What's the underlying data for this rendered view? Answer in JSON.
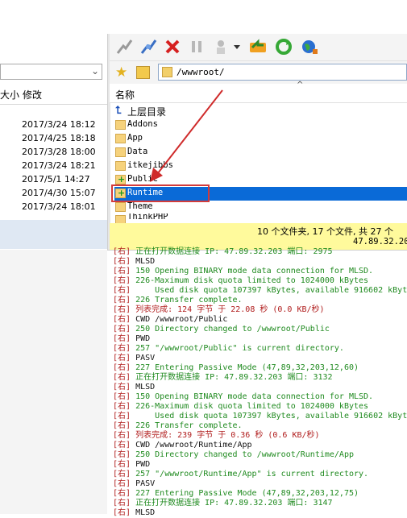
{
  "left": {
    "header_size": "大小",
    "header_modified": "修改",
    "dates": [
      "2017/3/24 18:12",
      "2017/4/25 18:18",
      "2017/3/28 18:00",
      "2017/3/24 18:21",
      "2017/5/1 14:27",
      "2017/4/30 15:07",
      "2017/3/24 18:01"
    ]
  },
  "right": {
    "path": "/wwwroot/",
    "col_name": "名称",
    "items": [
      "上层目录",
      "Addons",
      "App",
      "Data",
      "itkejibbs",
      "Public",
      "Runtime",
      "Theme",
      "ThinkPHP"
    ],
    "status_line1": "10 个文件夹, 17 个文件, 共 27 个",
    "status_line2": "47.89.32.20"
  },
  "toolbar_icons": [
    "connect-icon",
    "disconnect-icon",
    "stop-icon",
    "pause-icon",
    "transfer-icon",
    "dropdown-icon",
    "sync-icon",
    "refresh-icon",
    "globe-icon"
  ],
  "log": [
    {
      "tag": "[右]",
      "text": " 正在打开数据连接 IP: 47.89.32.203 端口: 2975",
      "c": "g"
    },
    {
      "tag": "[右]",
      "text": " MLSD",
      "c": "k"
    },
    {
      "tag": "[右]",
      "text": " 150 Opening BINARY mode data connection for MLSD.",
      "c": "g"
    },
    {
      "tag": "[右]",
      "text": " 226-Maximum disk quota limited to 1024000 kBytes",
      "c": "g"
    },
    {
      "tag": "[右]",
      "text": "     Used disk quota 107397 kBytes, available 916602 kByt",
      "c": "g"
    },
    {
      "tag": "[右]",
      "text": " 226 Transfer complete.",
      "c": "g"
    },
    {
      "tag": "[右]",
      "text": " 列表完成: 124 字节 于 22.08 秒 (0.0 KB/秒)",
      "c": "r"
    },
    {
      "tag": "[右]",
      "text": " CWD /wwwroot/Public",
      "c": "k"
    },
    {
      "tag": "[右]",
      "text": " 250 Directory changed to /wwwroot/Public",
      "c": "g"
    },
    {
      "tag": "[右]",
      "text": " PWD",
      "c": "k"
    },
    {
      "tag": "[右]",
      "text": " 257 \"/wwwroot/Public\" is current directory.",
      "c": "g"
    },
    {
      "tag": "[右]",
      "text": " PASV",
      "c": "k"
    },
    {
      "tag": "[右]",
      "text": " 227 Entering Passive Mode (47,89,32,203,12,60)",
      "c": "g"
    },
    {
      "tag": "[右]",
      "text": " 正在打开数据连接 IP: 47.89.32.203 端口: 3132",
      "c": "g"
    },
    {
      "tag": "[右]",
      "text": " MLSD",
      "c": "k"
    },
    {
      "tag": "[右]",
      "text": " 150 Opening BINARY mode data connection for MLSD.",
      "c": "g"
    },
    {
      "tag": "[右]",
      "text": " 226-Maximum disk quota limited to 1024000 kBytes",
      "c": "g"
    },
    {
      "tag": "[右]",
      "text": "     Used disk quota 107397 kBytes, available 916602 kByt",
      "c": "g"
    },
    {
      "tag": "[右]",
      "text": " 226 Transfer complete.",
      "c": "g"
    },
    {
      "tag": "[右]",
      "text": " 列表完成: 239 字节 于 0.36 秒 (0.6 KB/秒)",
      "c": "r"
    },
    {
      "tag": "[右]",
      "text": " CWD /wwwroot/Runtime/App",
      "c": "k"
    },
    {
      "tag": "[右]",
      "text": " 250 Directory changed to /wwwroot/Runtime/App",
      "c": "g"
    },
    {
      "tag": "[右]",
      "text": " PWD",
      "c": "k"
    },
    {
      "tag": "[右]",
      "text": " 257 \"/wwwroot/Runtime/App\" is current directory.",
      "c": "g"
    },
    {
      "tag": "[右]",
      "text": " PASV",
      "c": "k"
    },
    {
      "tag": "[右]",
      "text": " 227 Entering Passive Mode (47,89,32,203,12,75)",
      "c": "g"
    },
    {
      "tag": "[右]",
      "text": " 正在打开数据连接 IP: 47.89.32.203 端口: 3147",
      "c": "g"
    },
    {
      "tag": "[右]",
      "text": " MLSD",
      "c": "k"
    }
  ]
}
